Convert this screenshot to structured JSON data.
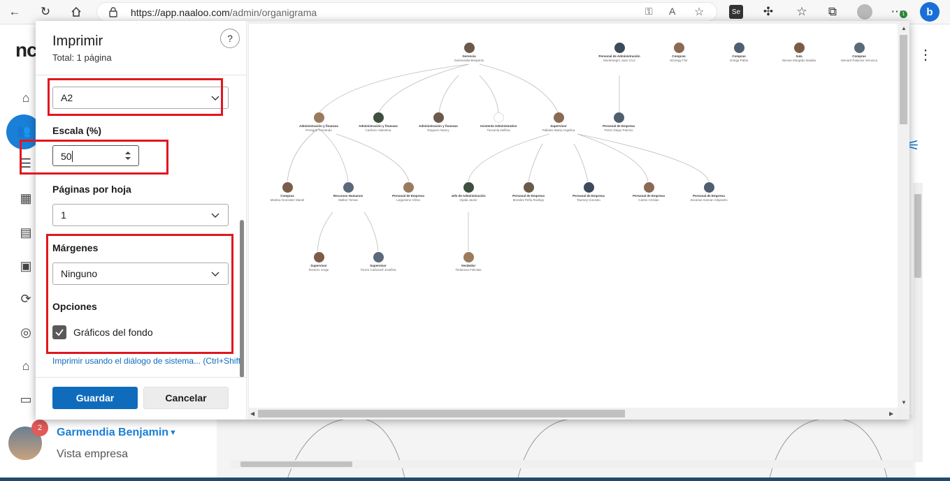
{
  "browser": {
    "url_host": "https://app.naaloo.com",
    "url_path": "/admin/organigrama",
    "profile_badge": "Se",
    "notification_badge": "1"
  },
  "app": {
    "logo_text": "nc",
    "user": {
      "name": "Garmendia Benjamin",
      "role": "Vista empresa",
      "notifications": "2"
    }
  },
  "print": {
    "title": "Imprimir",
    "subtitle": "Total: 1 página",
    "paper_size": "A2",
    "scale_label": "Escala (%)",
    "scale_value": "50",
    "pages_per_sheet_label": "Páginas por hoja",
    "pages_per_sheet_value": "1",
    "margins_label": "Márgenes",
    "margins_value": "Ninguno",
    "options_label": "Opciones",
    "background_graphics_label": "Gráficos del fondo",
    "background_graphics_checked": true,
    "system_dialog_link": "Imprimir usando el diálogo de sistema... (Ctrl+Shift+P)",
    "save_label": "Guardar",
    "cancel_label": "Cancelar",
    "help_label": "?"
  },
  "org_chart": {
    "nodes": [
      {
        "id": "n0",
        "role": "Gerencia",
        "name": "Garmendia Benjamin"
      },
      {
        "id": "n1",
        "role": "Personal de Administración",
        "name": "Montenegro Juan Cruz"
      },
      {
        "id": "n2",
        "role": "Compras",
        "name": "Strology Flor"
      },
      {
        "id": "n3",
        "role": "Compras",
        "name": "Ortega Pablo"
      },
      {
        "id": "n4",
        "role": "Sala",
        "name": "Nievas Morgado Natalia"
      },
      {
        "id": "n5",
        "role": "Compras",
        "name": "Menard Palacios Veronica"
      },
      {
        "id": "n6",
        "role": "Administración y finanzas",
        "name": "Peregrin Fernando"
      },
      {
        "id": "n7",
        "role": "Administración y finanzas",
        "name": "Cardozo Valentina"
      },
      {
        "id": "n8",
        "role": "Administración y finanzas",
        "name": "Reguero Nancy"
      },
      {
        "id": "n9",
        "role": "Asistente Administrativo",
        "name": "Toscania Delfina"
      },
      {
        "id": "n10",
        "role": "Supervisor",
        "name": "Pallales Maria Angelica"
      },
      {
        "id": "n11",
        "role": "Personal de Empresa",
        "name": "Perez Diego Patricio"
      },
      {
        "id": "n12",
        "role": "Compras",
        "name": "Medina Gonzalez Mariel"
      },
      {
        "id": "n13",
        "role": "Recursos Humanos",
        "name": "Mallon Tomas"
      },
      {
        "id": "n14",
        "role": "Personal de Empresa",
        "name": "Legazamo Vilma"
      },
      {
        "id": "n15",
        "role": "Jefe de Administración",
        "name": "Opala Javier"
      },
      {
        "id": "n16",
        "role": "Personal de Empresa",
        "name": "Morales Peña Rodrigo"
      },
      {
        "id": "n17",
        "role": "Personal de Empresa",
        "name": "Taumey Gonzalo"
      },
      {
        "id": "n18",
        "role": "Personal de Empresa",
        "name": "Carlos Cristian"
      },
      {
        "id": "n19",
        "role": "Personal de Empresa",
        "name": "Zacarias Gaman Alejandro"
      },
      {
        "id": "n20",
        "role": "Supervisor",
        "name": "Romero Jorge"
      },
      {
        "id": "n21",
        "role": "Supervisor",
        "name": "Torres Carbonell Josefina"
      },
      {
        "id": "n22",
        "role": "Vendedor",
        "name": "Terlanova Felicitas"
      }
    ]
  },
  "colors": {
    "accent": "#0f6cbd",
    "highlight": "#e0171f",
    "app_blue": "#1a7fd6"
  }
}
